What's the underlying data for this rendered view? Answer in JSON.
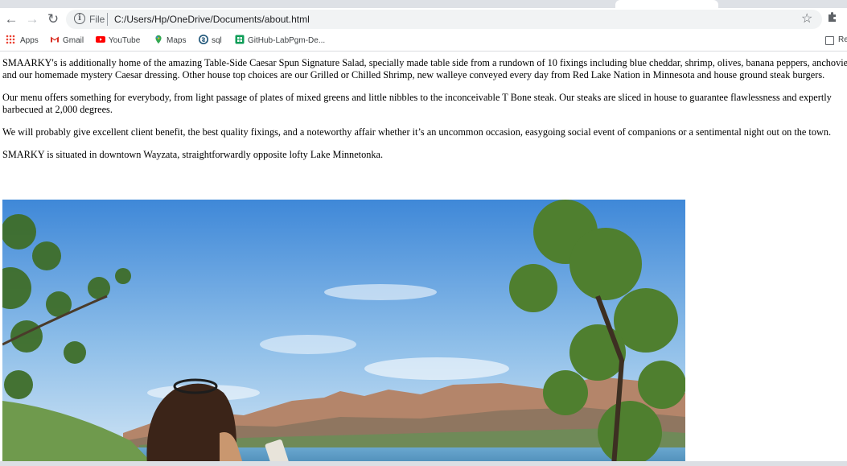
{
  "browser": {
    "url_scheme_label": "File",
    "url": "C:/Users/Hp/OneDrive/Documents/about.html",
    "bookmarks": [
      "Apps",
      "Gmail",
      "YouTube",
      "Maps",
      "sql",
      "GitHub-LabPgm-De..."
    ],
    "reading_list_label": "Re"
  },
  "page": {
    "paragraphs": [
      "SMAARKY's is additionally home of the amazing Table-Side Caesar Spun Signature Salad, specially made table side from a rundown of 10 fixings including blue cheddar, shrimp, olives, banana peppers, anchovies and our homemade mystery Caesar dressing. Other house top choices are our Grilled or Chilled Shrimp, new walleye conveyed every day from Red Lake Nation in Minnesota and house ground steak burgers.",
      "Our menu offers something for everybody, from light passage of plates of mixed greens and little nibbles to the inconceivable T Bone steak. Our steaks are sliced in house to guarantee flawlessness and expertly barbecued at 2,000 degrees.",
      "We will probably give excellent client benefit, the best quality fixings, and a noteworthy affair whether it’s an uncommon occasion, easygoing social event of companions or a sentimental night out on the town.",
      "SMARKY is situated in downtown Wayzata, straightforwardly opposite lofty Lake Minnetonka."
    ]
  },
  "colors": {
    "sky_top": "#3f88d8",
    "sky_bottom": "#bcd9f2",
    "toolbar_bg": "#ffffff",
    "tabstrip_bg": "#dee1e6"
  }
}
